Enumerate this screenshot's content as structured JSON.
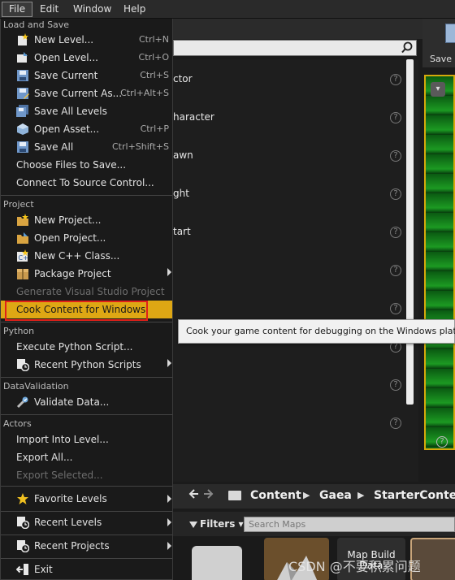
{
  "menubar": {
    "items": [
      {
        "label": "File"
      },
      {
        "label": "Edit"
      },
      {
        "label": "Window"
      },
      {
        "label": "Help"
      }
    ]
  },
  "file_menu": {
    "sections": {
      "load_and_save": "Load and Save",
      "project": "Project",
      "python": "Python",
      "data_validation": "DataValidation",
      "actors": "Actors"
    },
    "items": {
      "new_level": {
        "label": "New Level...",
        "shortcut": "Ctrl+N"
      },
      "open_level": {
        "label": "Open Level...",
        "shortcut": "Ctrl+O"
      },
      "save_current": {
        "label": "Save Current",
        "shortcut": "Ctrl+S"
      },
      "save_current_as": {
        "label": "Save Current As...",
        "shortcut": "Ctrl+Alt+S"
      },
      "save_all_levels": {
        "label": "Save All Levels"
      },
      "open_asset": {
        "label": "Open Asset...",
        "shortcut": "Ctrl+P"
      },
      "save_all": {
        "label": "Save All",
        "shortcut": "Ctrl+Shift+S"
      },
      "choose_files": {
        "label": "Choose Files to Save..."
      },
      "connect_source": {
        "label": "Connect To Source Control..."
      },
      "new_project": {
        "label": "New Project..."
      },
      "open_project": {
        "label": "Open Project..."
      },
      "new_cpp_class": {
        "label": "New C++ Class..."
      },
      "package_project": {
        "label": "Package Project"
      },
      "generate_vs": {
        "label": "Generate Visual Studio Project"
      },
      "cook_content": {
        "label": "Cook Content for Windows"
      },
      "execute_python": {
        "label": "Execute Python Script..."
      },
      "recent_python": {
        "label": "Recent Python Scripts"
      },
      "validate_data": {
        "label": "Validate Data..."
      },
      "import_into_level": {
        "label": "Import Into Level..."
      },
      "export_all": {
        "label": "Export All..."
      },
      "export_selected": {
        "label": "Export Selected..."
      },
      "favorite_levels": {
        "label": "Favorite Levels"
      },
      "recent_levels": {
        "label": "Recent Levels"
      },
      "recent_projects": {
        "label": "Recent Projects"
      },
      "exit": {
        "label": "Exit"
      }
    }
  },
  "tooltip": {
    "text": "Cook your game content for debugging on the Windows platform"
  },
  "background": {
    "rows": [
      "ctor",
      "haracter",
      "awn",
      "ght",
      "tart"
    ],
    "help_glyph": "?",
    "save_button": "Save C",
    "viewport_button": "▾"
  },
  "content_browser": {
    "breadcrumbs": [
      "Content",
      "Gaea",
      "StarterContent"
    ],
    "filters_label": "Filters ▾",
    "search_placeholder": "Search Maps",
    "tile_name": "Map Build Data"
  },
  "watermark": "CSDN @不要积累问题",
  "colors": {
    "highlight": "#dea714",
    "annotation_red": "#e0201a",
    "viewport_border": "#d4a90c"
  }
}
